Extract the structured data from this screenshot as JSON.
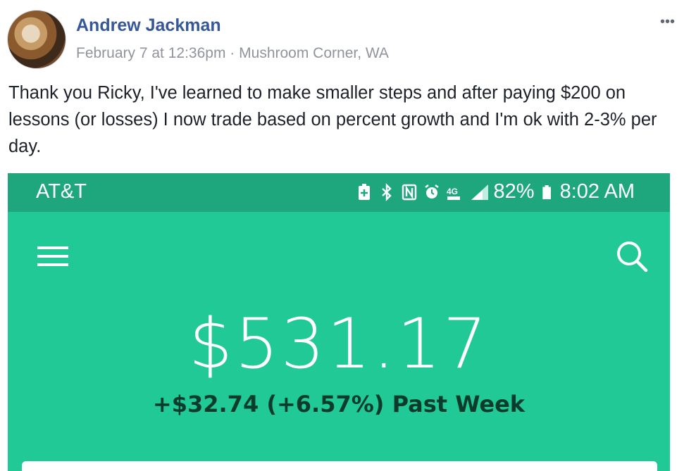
{
  "post": {
    "author": "Andrew Jackman",
    "timestamp": "February 7 at 12:36pm",
    "separator": "·",
    "location": "Mushroom Corner, WA",
    "more_icon": "more-options-icon",
    "more_glyph": "•••",
    "text": "Thank you Ricky, I've learned to make smaller steps and after paying $200 on lessons (or losses) I now trade based on percent growth and I'm ok with 2-3% per day."
  },
  "phone": {
    "carrier": "AT&T",
    "status_icons": [
      "battery-saver-icon",
      "bluetooth-icon",
      "nfc-icon",
      "alarm-icon",
      "4g-lte-icon",
      "signal-icon"
    ],
    "network_label": "4G",
    "battery_percent": "82%",
    "time": "8:02 AM",
    "balance": "$531.17",
    "change": "+$32.74 (+6.57%) Past Week"
  },
  "colors": {
    "author_link": "#365899",
    "app_green": "#21c997",
    "status_bar": "#1ea77d",
    "change_text": "#0b3b2b"
  }
}
